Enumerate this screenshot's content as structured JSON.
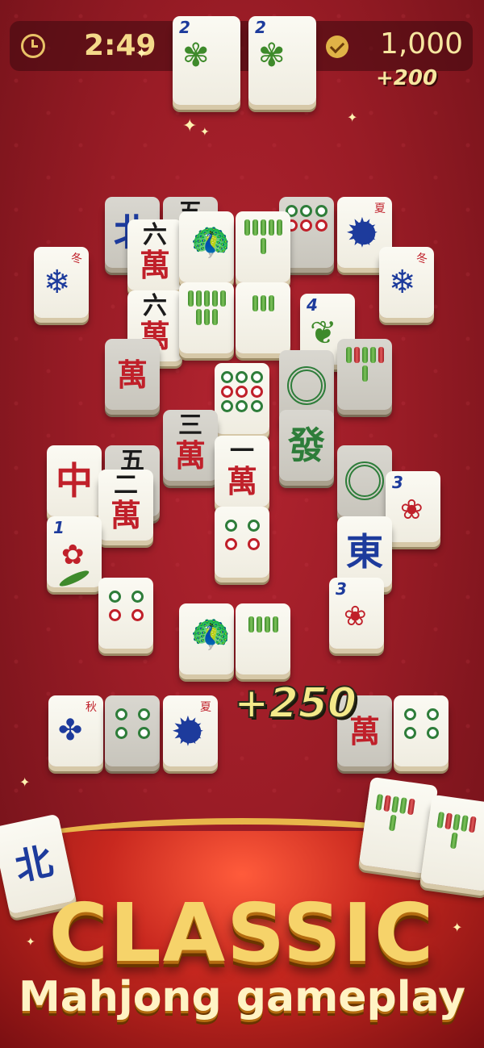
{
  "hud": {
    "timer": "2:49",
    "score": "1,000",
    "bonus": "+200"
  },
  "combo_bonus": "+250",
  "banner": {
    "title": "CLASSIC",
    "subtitle": "Mahjong gameplay"
  },
  "tiles": {
    "six_wan": "六",
    "wan": "萬",
    "five": "五",
    "two": "二",
    "three": "三",
    "one": "一",
    "north": "北",
    "east": "東",
    "green_dragon": "發",
    "red_dragon": "中",
    "winter": "冬",
    "summer": "夏",
    "autumn": "秋",
    "num_2": "2",
    "num_4": "4",
    "num_3": "3",
    "num_1": "1"
  },
  "colors": {
    "background": "#9a1c26",
    "gold": "#f6d36a",
    "tile_face": "#fbfaf3"
  }
}
